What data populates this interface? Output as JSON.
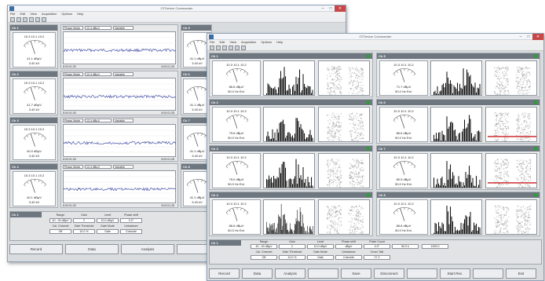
{
  "window_back": {
    "title": "OTDevice Commander",
    "menu": [
      "File",
      "Edit",
      "View",
      "Acquisition",
      "Options",
      "Help"
    ],
    "channels": [
      {
        "id": "Ch 1",
        "scale": [
          "10.3",
          "10.1",
          "10.2"
        ],
        "scale_side": [
          "80.0",
          "80.2"
        ],
        "reading_db": "41.1 dBµV",
        "reading_kv": "3.40 kV",
        "time_left": "8:00:01:28",
        "time_right": "8:00:01:28",
        "ctrl": [
          "Phase Mode",
          "12.4 dBµV",
          "Variable"
        ]
      },
      {
        "id": "Ch 2",
        "scale": [
          "10.3",
          "10.1",
          "10.2"
        ],
        "scale_side": [
          "80.0",
          "80.2"
        ],
        "reading_db": "41.7 dBµV",
        "reading_kv": "3.40 kV",
        "time_left": "8:00:01:28",
        "time_right": "8:00:01:28",
        "ctrl": [
          "Phase Mode",
          "12.4 dBµV",
          "Variable"
        ]
      },
      {
        "id": "Ch 3",
        "scale": [
          "10.3",
          "10.1",
          "10.2"
        ],
        "scale_side": [
          "80.0",
          "80.2"
        ],
        "reading_db": "40.0 dBµV",
        "reading_kv": "3.40 kV",
        "time_left": "8:00:01:28",
        "time_right": "8:00:01:28",
        "ctrl": [
          "Phase Mode",
          "12.4 dBµV",
          "Variable"
        ]
      },
      {
        "id": "Ch 4",
        "scale": [
          "10.3",
          "10.1",
          "10.2"
        ],
        "scale_side": [
          "80.0",
          "80.2"
        ],
        "reading_db": "40.1 dBµV",
        "reading_kv": "3.40 kV",
        "time_left": "8:00:01:28",
        "time_right": "8:00:01:28",
        "ctrl": [
          "Phase Mode",
          "12.4 dBµV",
          "Variable"
        ]
      }
    ],
    "right_ids": [
      "Ch 5",
      "Ch 6",
      "Ch 7",
      "Ch 8"
    ],
    "right_db": [
      "41.1 dBµV",
      "41.1 dBµV",
      "41.1 dBµV",
      "41.1 dBµV"
    ],
    "right_kv": [
      "3.40 kV",
      "3.40 kV",
      "3.40 kV",
      "3.40 kV"
    ],
    "bottom": {
      "ch": "Ch 1",
      "labels": [
        "Range",
        "Gain",
        "Level",
        "Phase shift"
      ],
      "values": [
        "40 - 90 dBµV",
        "2",
        "10.0 dBµV",
        "0.0°"
      ],
      "labels2": [
        "Cal. Channel",
        "Gate Threshold",
        "Gate Mode",
        "Unbalance"
      ],
      "values2": [
        "Off",
        "10.0 %",
        "Gate",
        "Coincide"
      ]
    },
    "buttons": [
      "Record",
      "Data",
      "Analysis",
      "",
      "",
      "Disconnect"
    ]
  },
  "window_front": {
    "title": "OTDevice Commander",
    "menu": [
      "File",
      "Edit",
      "View",
      "Acquisition",
      "Options",
      "Help"
    ],
    "channels": [
      {
        "id": "Ch 1",
        "reading": "86.6 dBµV",
        "sub": "50.0 Hz Ext.",
        "scale": [
          "10.3",
          "10.1",
          "10.2"
        ]
      },
      {
        "id": "Ch 2",
        "reading": "79.6 dBµV",
        "sub": "50.0 Hz Ext.",
        "scale": [
          "10.3",
          "10.1",
          "10.2"
        ]
      },
      {
        "id": "Ch 3",
        "reading": "75.0 dBµV",
        "sub": "50.0 Hz Ext.",
        "scale": [
          "10.3",
          "10.1",
          "10.2"
        ]
      },
      {
        "id": "Ch 4",
        "reading": "86.6 dBµV",
        "sub": "50.0 Hz Ext.",
        "scale": [
          "10.3",
          "10.1",
          "10.2"
        ]
      },
      {
        "id": "Ch 5",
        "reading": "71.7 dBµV",
        "sub": "50.0 Hz Ext.",
        "scale": [
          "10.3",
          "10.1",
          "10.2"
        ]
      },
      {
        "id": "Ch 6",
        "reading": "86.6 dBµV",
        "sub": "50.0 Hz Ext.",
        "scale": [
          "10.3",
          "10.1",
          "10.2"
        ]
      },
      {
        "id": "Ch 7",
        "reading": "80.5 dBµV",
        "sub": "50.0 Hz Ext.",
        "scale": [
          "10.3",
          "10.1",
          "10.2"
        ]
      },
      {
        "id": "Ch 8",
        "reading": "86.6 dBµV",
        "sub": "50.0 Hz Ext.",
        "scale": [
          "10.3",
          "10.1",
          "10.2"
        ]
      }
    ],
    "bottom": {
      "ch": "Ch 1",
      "labels": [
        "Range",
        "Gain",
        "Level",
        "Phase shift",
        "Pulse Count"
      ],
      "values": [
        "40 - 90 dBµV",
        "2",
        "10.0 dBµV",
        "dBµV",
        "0.0°",
        "50.0 k",
        "1000.0"
      ],
      "labels2": [
        "Cal. Channel",
        "Gate Threshold",
        "Gate Mode",
        "Unbalance",
        "Cross Talk"
      ],
      "values2": [
        "Off",
        "10.0 %",
        "Gate",
        "Coincide",
        "27.3"
      ]
    },
    "buttons": [
      "Record",
      "Data",
      "Analysis",
      "",
      "Save",
      "Disconnect",
      "",
      "Start Rec.",
      "",
      "Exit"
    ]
  }
}
